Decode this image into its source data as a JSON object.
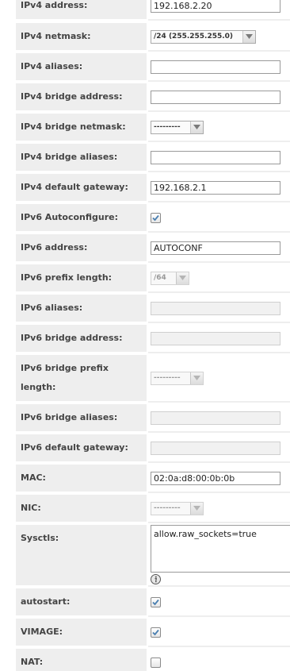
{
  "form": {
    "rows": [
      {
        "label": "IPv4 address:",
        "type": "text",
        "value": "192.168.2.20"
      },
      {
        "label": "IPv4 netmask:",
        "type": "select",
        "value": "/24 (255.255.255.0)"
      },
      {
        "label": "IPv4 aliases:",
        "type": "text",
        "value": ""
      },
      {
        "label": "IPv4 bridge address:",
        "type": "text",
        "value": ""
      },
      {
        "label": "IPv4 bridge netmask:",
        "type": "select",
        "value": "---------"
      },
      {
        "label": "IPv4 bridge aliases:",
        "type": "text",
        "value": ""
      },
      {
        "label": "IPv4 default gateway:",
        "type": "text",
        "value": "192.168.2.1"
      },
      {
        "label": "IPv6 Autoconfigure:",
        "type": "checkbox",
        "checked": true
      },
      {
        "label": "IPv6 address:",
        "type": "text",
        "value": "AUTOCONF"
      },
      {
        "label": "IPv6 prefix length:",
        "type": "select",
        "value": "/64",
        "disabled": true
      },
      {
        "label": "IPv6 aliases:",
        "type": "text",
        "value": "",
        "disabled": true
      },
      {
        "label": "IPv6 bridge address:",
        "type": "text",
        "value": "",
        "disabled": true
      },
      {
        "label": "IPv6 bridge prefix length:",
        "type": "select",
        "value": "---------",
        "disabled": true
      },
      {
        "label": "IPv6 bridge aliases:",
        "type": "text",
        "value": "",
        "disabled": true
      },
      {
        "label": "IPv6 default gateway:",
        "type": "text",
        "value": "",
        "disabled": true
      },
      {
        "label": "MAC:",
        "type": "text",
        "value": "02:0a:d8:00:0b:0b"
      },
      {
        "label": "NIC:",
        "type": "select",
        "value": "---------",
        "disabled": true
      },
      {
        "label": "Sysctls:",
        "type": "textarea",
        "value": "allow.raw_sockets=true",
        "help_icon": "info-icon"
      },
      {
        "label": "autostart:",
        "type": "checkbox",
        "checked": true
      },
      {
        "label": "VIMAGE:",
        "type": "checkbox",
        "checked": true
      },
      {
        "label": "NAT:",
        "type": "checkbox",
        "checked": false
      }
    ]
  },
  "colors": {
    "label_bg": "#eeeeee",
    "checkmark": "#4a7fb0",
    "help_icon": "#555555"
  }
}
